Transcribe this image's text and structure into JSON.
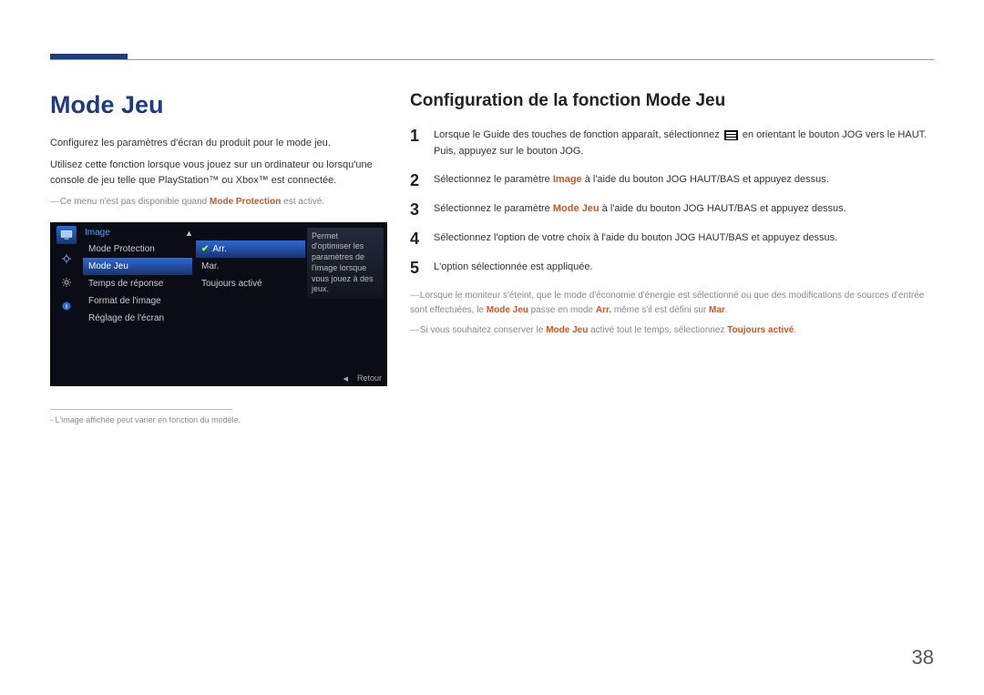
{
  "page_number": "38",
  "left": {
    "title": "Mode Jeu",
    "p1": "Configurez les paramètres d'écran du produit pour le mode jeu.",
    "p2": "Utilisez cette fonction lorsque vous jouez sur un ordinateur ou lorsqu'une console de jeu telle que PlayStation™ ou Xbox™ est connectée.",
    "note1_pre": "Ce menu n'est pas disponible quand ",
    "note1_bold": "Mode Protection",
    "note1_post": " est activé.",
    "footnote": "L'image affichée peut varier en fonction du modèle."
  },
  "osd": {
    "category": "Image",
    "items": [
      "Mode Protection",
      "Mode Jeu",
      "Temps de réponse",
      "Format de l'image",
      "Réglage de l'écran"
    ],
    "selected_index": 1,
    "options": [
      "Arr.",
      "Mar.",
      "Toujours activé"
    ],
    "option_selected_index": 0,
    "description": "Permet d'optimiser les paramètres de l'image lorsque vous jouez à des jeux.",
    "back_label": "Retour"
  },
  "right": {
    "title": "Configuration de la fonction Mode Jeu",
    "steps": [
      {
        "n": "1",
        "pre": "Lorsque le Guide des touches de fonction apparaît, sélectionnez ",
        "post": " en orientant le bouton JOG vers le HAUT. Puis, appuyez sur le bouton JOG."
      },
      {
        "n": "2",
        "pre": "Sélectionnez le paramètre ",
        "bold": "Image",
        "post": " à l'aide du bouton JOG HAUT/BAS et appuyez dessus."
      },
      {
        "n": "3",
        "pre": "Sélectionnez le paramètre ",
        "bold": "Mode Jeu",
        "post": " à l'aide du bouton JOG HAUT/BAS et appuyez dessus."
      },
      {
        "n": "4",
        "text": "Sélectionnez l'option de votre choix à l'aide du bouton JOG HAUT/BAS et appuyez dessus."
      },
      {
        "n": "5",
        "text": "L'option sélectionnée est appliquée."
      }
    ],
    "note_a": {
      "pre": "Lorsque le moniteur s'éteint, que le mode d'économie d'énergie est sélectionné ou que des modifications de sources d'entrée sont effectuées, le ",
      "b1": "Mode Jeu",
      "mid1": " passe en mode ",
      "b2": "Arr.",
      "mid2": " même s'il est défini sur ",
      "b3": "Mar",
      "post": "."
    },
    "note_b": {
      "pre": "Si vous souhaitez conserver le ",
      "b1": "Mode Jeu",
      "mid": " activé tout le temps, sélectionnez ",
      "b2": "Toujours activé",
      "post": "."
    }
  }
}
